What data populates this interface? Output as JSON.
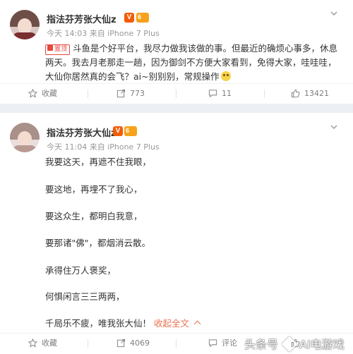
{
  "post1": {
    "author": "指法芬芳张大仙z",
    "vip_level": "6",
    "meta": "今天 14:03 来自 iPhone 7 Plus",
    "pin_label": "置顶",
    "text": "斗鱼是个好平台，我尽力做我该做的事。但最近的确烦心事多，休息两天。我去月老那走一趟，因为御剑不方便大家看到，免得大家，哇哇哇，大仙你居然真的会飞？ai~别别别，常规操作",
    "actions": [
      {
        "icon": "star-icon",
        "label": "收藏"
      },
      {
        "icon": "share-icon",
        "label": "773"
      },
      {
        "icon": "comment-icon",
        "label": "11"
      },
      {
        "icon": "like-icon",
        "label": "13421"
      }
    ]
  },
  "post2": {
    "author": "指法芬芳张大仙z",
    "vip_level": "6",
    "meta": "今天 11:04 来自 iPhone 7 Plus",
    "lines": [
      "我要这天，再遮不住我眼，",
      "要这地，再埋不了我心，",
      "要这众生，都明白我意，",
      "要那诸\"佛\"，都烟消云散。",
      "承得住万人褒奖，",
      "何惧闲言三三两两，",
      "千局乐不疲，唯我张大仙！"
    ],
    "collapse_label": "收起全文",
    "actions": [
      {
        "icon": "star-icon",
        "label": "收藏"
      },
      {
        "icon": "share-icon",
        "label": "4069"
      },
      {
        "icon": "comment-icon",
        "label": "评论"
      },
      {
        "icon": "like-icon",
        "label": ""
      }
    ]
  },
  "watermark": {
    "left": "头条号",
    "right": "AI电游戏"
  },
  "colors": {
    "accent": "#eb7350",
    "v_badge": "#f25c05",
    "page_bg": "#eceff3"
  }
}
